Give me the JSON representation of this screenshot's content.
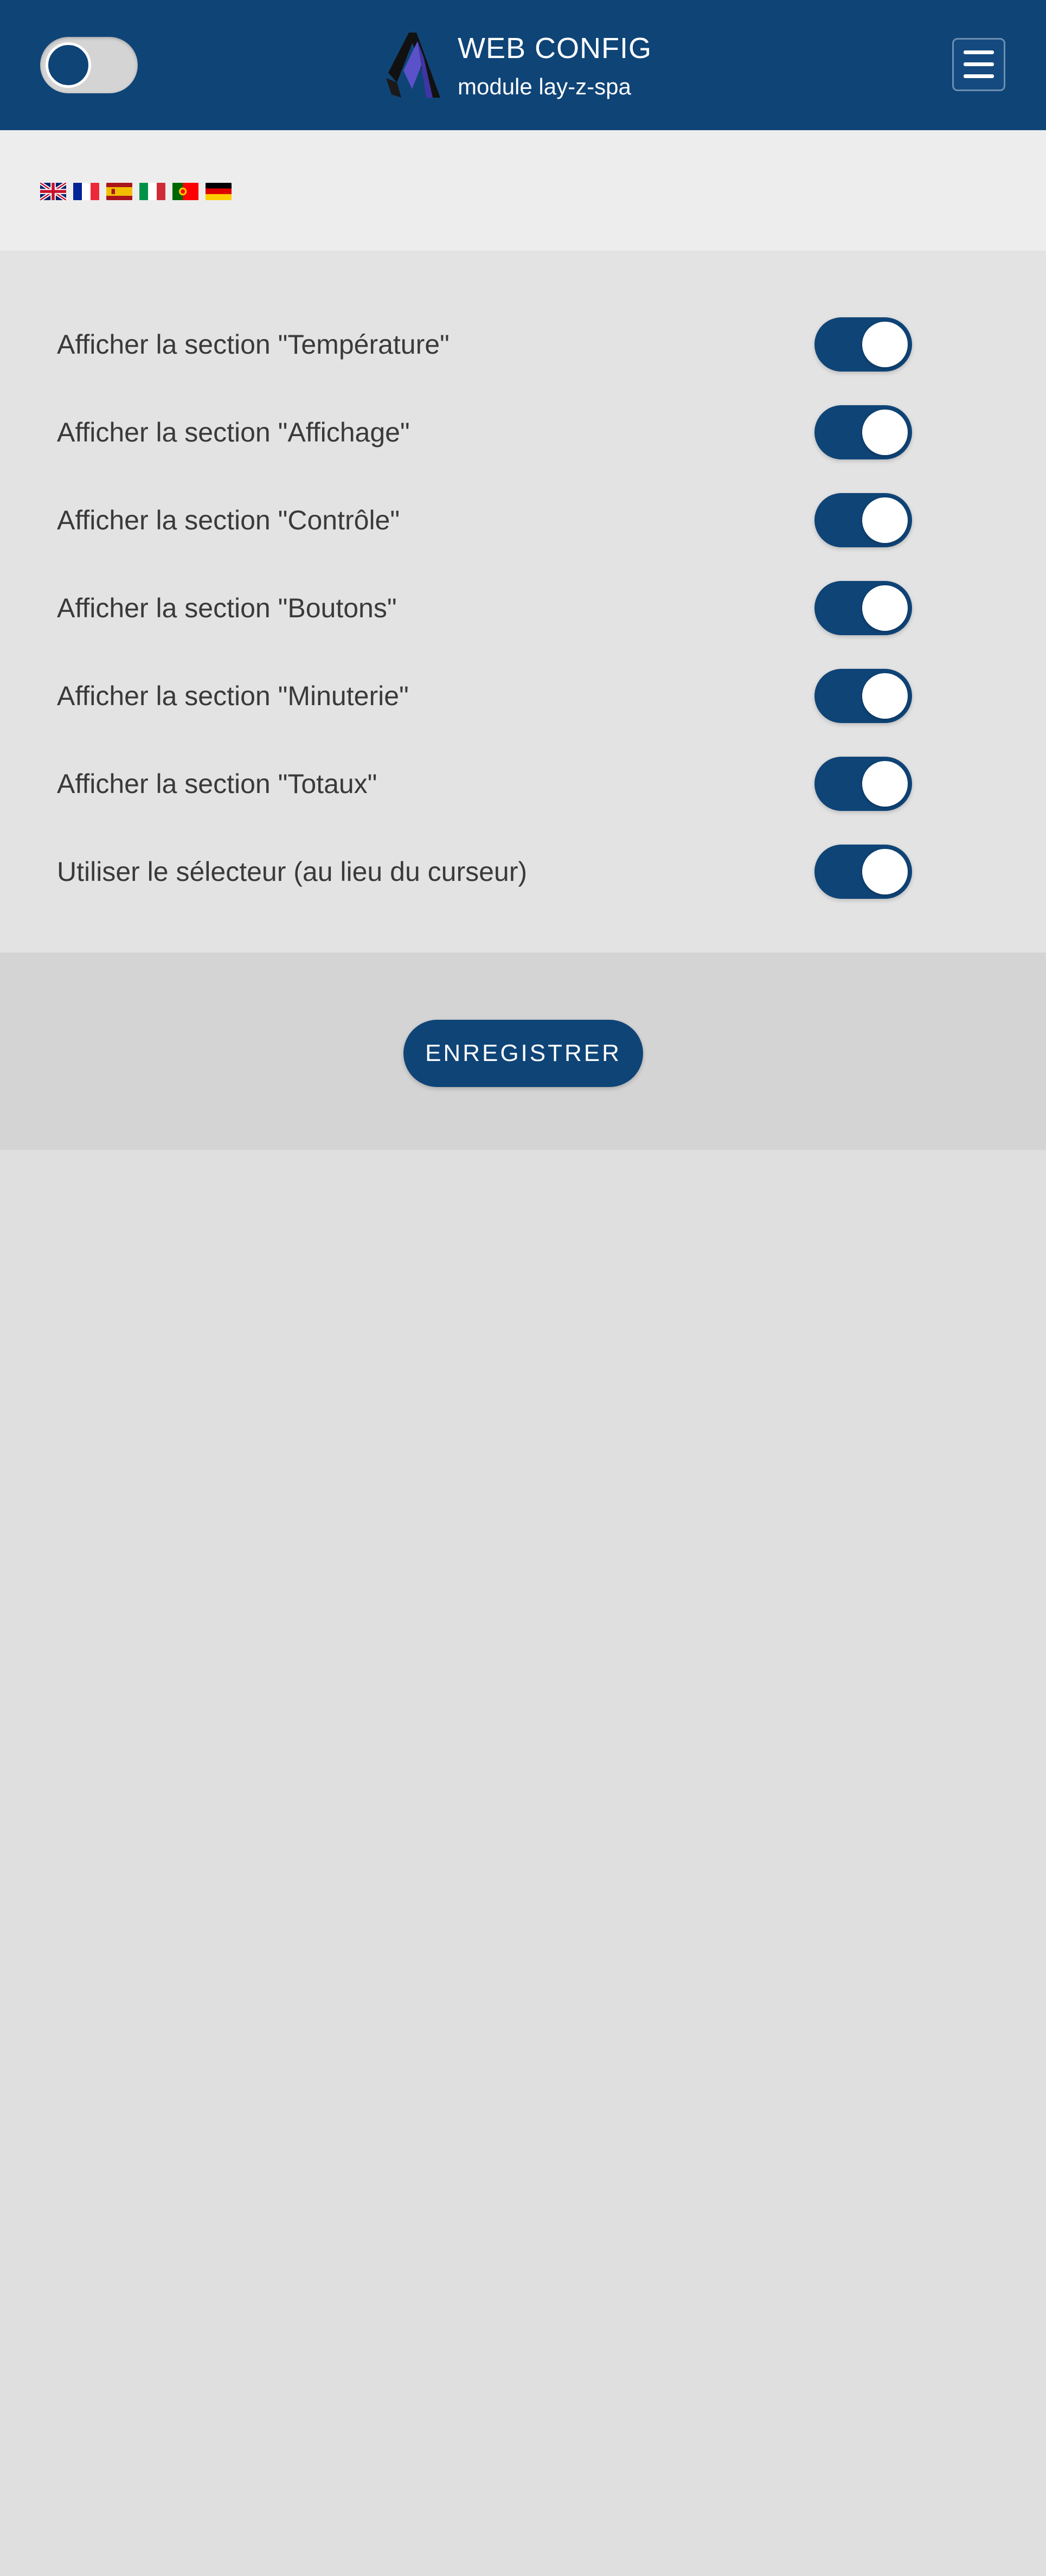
{
  "header": {
    "title": "WEB CONFIG",
    "subtitle": "module lay-z-spa",
    "theme_toggle_icon": "toggle-switch-icon",
    "logo_icon": "brand-logo-icon",
    "menu_icon": "hamburger-menu-icon"
  },
  "languages": [
    {
      "code": "en",
      "icon": "flag-uk-icon"
    },
    {
      "code": "fr",
      "icon": "flag-france-icon"
    },
    {
      "code": "es",
      "icon": "flag-spain-icon"
    },
    {
      "code": "it",
      "icon": "flag-italy-icon"
    },
    {
      "code": "pt",
      "icon": "flag-portugal-icon"
    },
    {
      "code": "de",
      "icon": "flag-germany-icon"
    }
  ],
  "settings": [
    {
      "label": "Afficher la section \"Température\"",
      "enabled": true
    },
    {
      "label": "Afficher la section \"Affichage\"",
      "enabled": true
    },
    {
      "label": "Afficher la section \"Contrôle\"",
      "enabled": true
    },
    {
      "label": "Afficher la section \"Boutons\"",
      "enabled": true
    },
    {
      "label": "Afficher la section \"Minuterie\"",
      "enabled": true
    },
    {
      "label": "Afficher la section \"Totaux\"",
      "enabled": true
    },
    {
      "label": "Utiliser le sélecteur (au lieu du curseur)",
      "enabled": true
    }
  ],
  "save": {
    "label": "ENREGISTRER"
  },
  "colors": {
    "primary": "#0f4477",
    "header_bg": "#0f4477",
    "lang_bar_bg": "#ededed",
    "settings_bg": "#e3e3e3",
    "save_bar_bg": "#d4d4d4",
    "page_bg": "#dfdfdf"
  }
}
